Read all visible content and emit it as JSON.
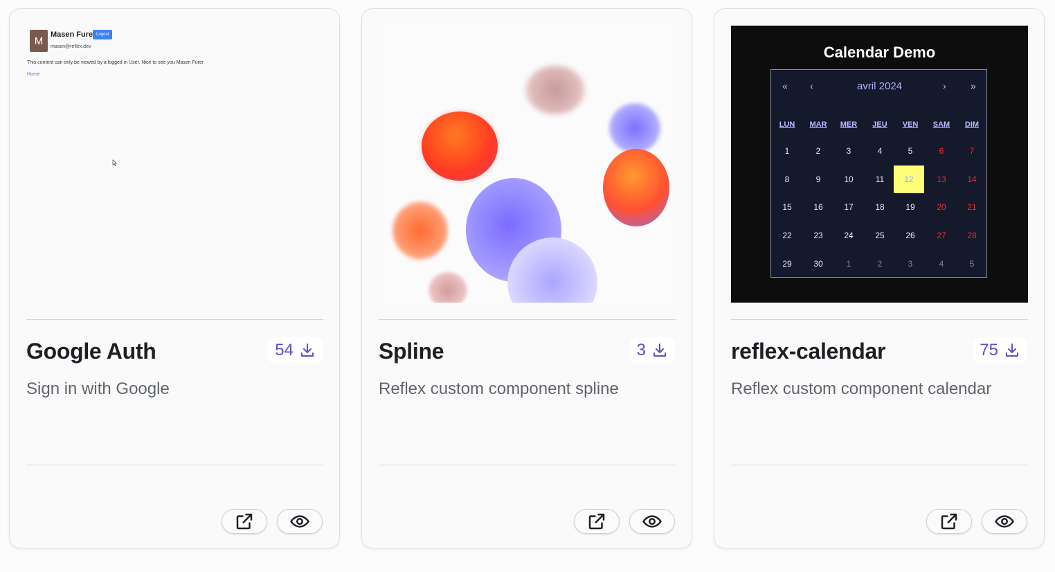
{
  "cards": [
    {
      "title": "Google Auth",
      "description": "Sign in with Google",
      "downloads": "54",
      "preview": {
        "avatar_letter": "M",
        "user_name": "Masen Furer",
        "logout_label": "Logout",
        "email": "masen@reflex.dev",
        "message": "This content can only be viewed by a logged in User. Nice to see you Masen Furer",
        "home_link": "Home"
      }
    },
    {
      "title": "Spline",
      "description": "Reflex custom component spline",
      "downloads": "3"
    },
    {
      "title": "reflex-calendar",
      "description": "Reflex custom component calendar",
      "downloads": "75",
      "preview": {
        "heading": "Calendar Demo",
        "month": "avril 2024",
        "nav": {
          "prev_year": "«",
          "prev_month": "‹",
          "next_month": "›",
          "next_year": "»"
        },
        "weekdays": [
          "LUN",
          "MAR",
          "MER",
          "JEU",
          "VEN",
          "SAM",
          "DIM"
        ],
        "weeks": [
          [
            "1",
            "2",
            "3",
            "4",
            "5",
            "6",
            "7"
          ],
          [
            "8",
            "9",
            "10",
            "11",
            "12",
            "13",
            "14"
          ],
          [
            "15",
            "16",
            "17",
            "18",
            "19",
            "20",
            "21"
          ],
          [
            "22",
            "23",
            "24",
            "25",
            "26",
            "27",
            "28"
          ],
          [
            "29",
            "30",
            "1",
            "2",
            "3",
            "4",
            "5"
          ]
        ],
        "selected_day": "12"
      }
    }
  ],
  "icons": {
    "download": "download-icon",
    "open": "external-link-icon",
    "preview": "eye-icon"
  },
  "colors": {
    "accent": "#5b4fc4",
    "weekend": "#e53030",
    "today_highlight": "#ffff77"
  }
}
